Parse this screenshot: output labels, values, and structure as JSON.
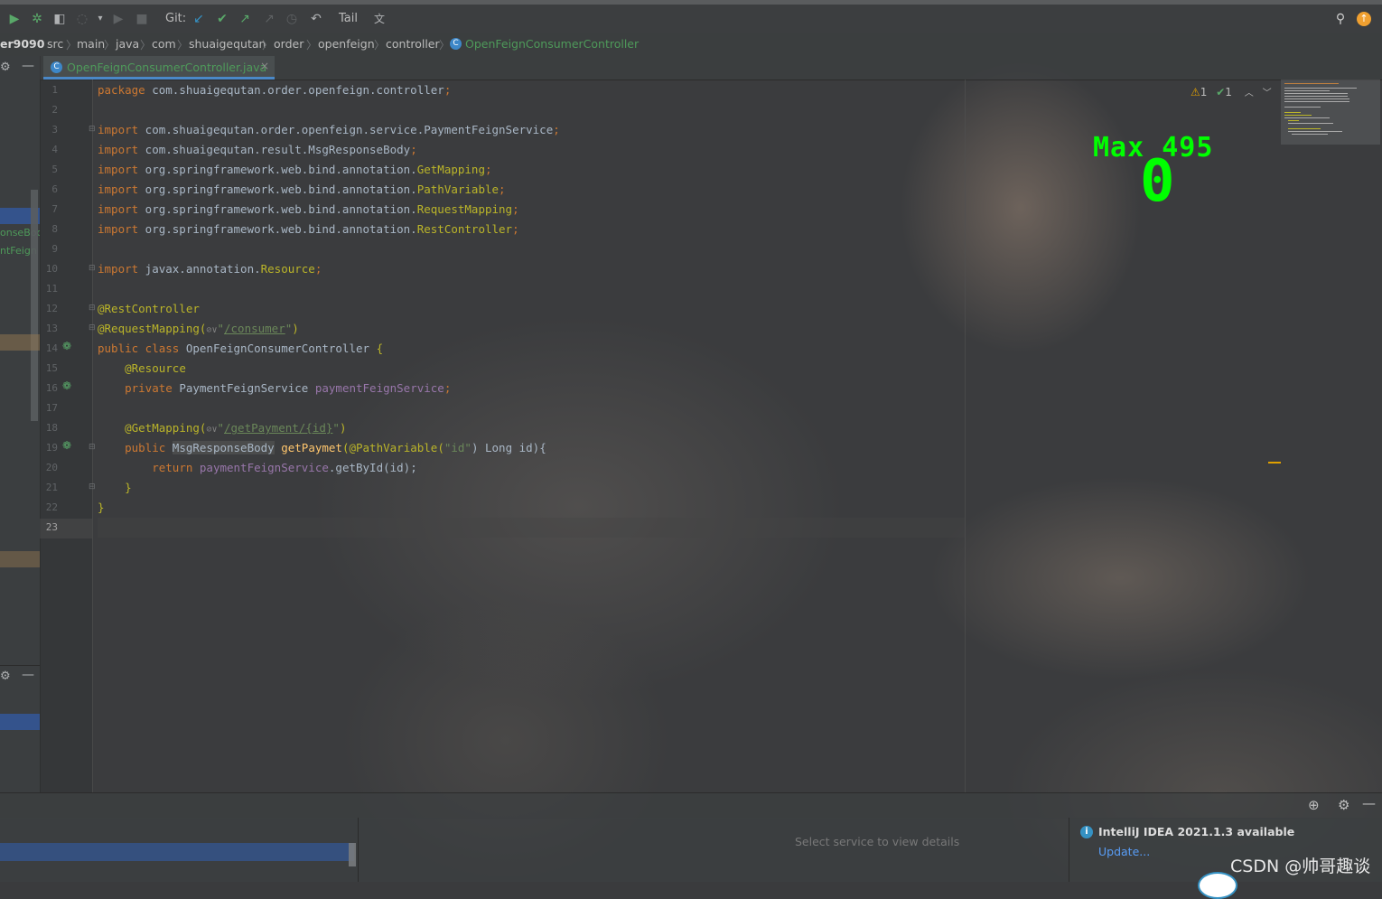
{
  "toolbar": {
    "git_label": "Git:",
    "tail_label": "Tail",
    "icons": [
      "run-icon",
      "debug-icon",
      "coverage-icon",
      "profile-icon",
      "dropdown-icon",
      "step-icon",
      "stop-icon",
      "git-update-icon",
      "git-commit-icon",
      "git-push-icon",
      "git-history-icon",
      "git-clock-icon",
      "undo-icon",
      "translate-icon",
      "search-icon",
      "update-badge-icon"
    ]
  },
  "breadcrumb": {
    "items": [
      "er9090",
      "src",
      "main",
      "java",
      "com",
      "shuaigequtan",
      "order",
      "openfeign",
      "controller",
      "OpenFeignConsumerController"
    ]
  },
  "editor_tab": {
    "label": "OpenFeignConsumerController.java",
    "close": "×"
  },
  "left_panel": {
    "text_1": "onseBod",
    "text_2": "ntFeign"
  },
  "inspections": {
    "warnings": "1",
    "ok": "1"
  },
  "line_numbers": [
    "1",
    "2",
    "3",
    "4",
    "5",
    "6",
    "7",
    "8",
    "9",
    "10",
    "11",
    "12",
    "13",
    "14",
    "15",
    "16",
    "17",
    "18",
    "19",
    "20",
    "21",
    "22",
    "23"
  ],
  "code": {
    "l1_kw": "package",
    "l1_rest": " com.shuaigequtan.order.openfeign.controller",
    "semi": ";",
    "import": "import",
    "l3_pkg": " com.shuaigequtan.order.openfeign.service.PaymentFeignService",
    "l4_pkg": " com.shuaigequtan.result.MsgResponseBody",
    "spring_pkg": " org.springframework.web.bind.annotation.",
    "l5_cls": "GetMapping",
    "l6_cls": "PathVariable",
    "l7_cls": "RequestMapping",
    "l8_cls": "RestController",
    "l10_pkg": " javax.annotation.",
    "l10_cls": "Resource",
    "l12": "@RestController",
    "l13_ann": "@RequestMapping(",
    "l13_icon": "⊘∨",
    "l13_q1": "\"",
    "l13_url": "/consumer",
    "l13_q2": "\"",
    "close_paren": ")",
    "l14_kw": "public class",
    "l14_name": " OpenFeignConsumerController ",
    "brace_open": "{",
    "l15": "@Resource",
    "l16_kw": "private",
    "l16_type": " PaymentFeignService ",
    "l16_fld": "paymentFeignService",
    "l18_ann": "@GetMapping(",
    "l18_icon": "⊘∨",
    "l18_q1": "\"",
    "l18_url": "/getPayment/{id}",
    "l18_q2": "\"",
    "l19_kw": "public",
    "l19_sp": " ",
    "l19_type": "MsgResponseBody",
    "l19_fn": "getPaymet",
    "l19_open": "(",
    "l19_ann": "@PathVariable(",
    "l19_str": "\"id\"",
    "l19_close": ") Long id){",
    "l20_kw": "return",
    "l20_fld": " paymentFeignService",
    "l20_rest": ".getById(id);",
    "brace_close": "}"
  },
  "overlay": {
    "max_label": "Max 495",
    "counter": "0"
  },
  "services": {
    "detail_placeholder": "Select service to view details"
  },
  "notification": {
    "title": "IntelliJ IDEA 2021.1.3 available",
    "action": "Update..."
  },
  "watermark": "CSDN @帅哥趣谈",
  "colors": {
    "keyword": "#cc7832",
    "string": "#6a8759",
    "annotation": "#bbb529",
    "field": "#9876aa",
    "method": "#ffc66d",
    "overlay_green": "#00ff00",
    "link_blue": "#589df6"
  }
}
